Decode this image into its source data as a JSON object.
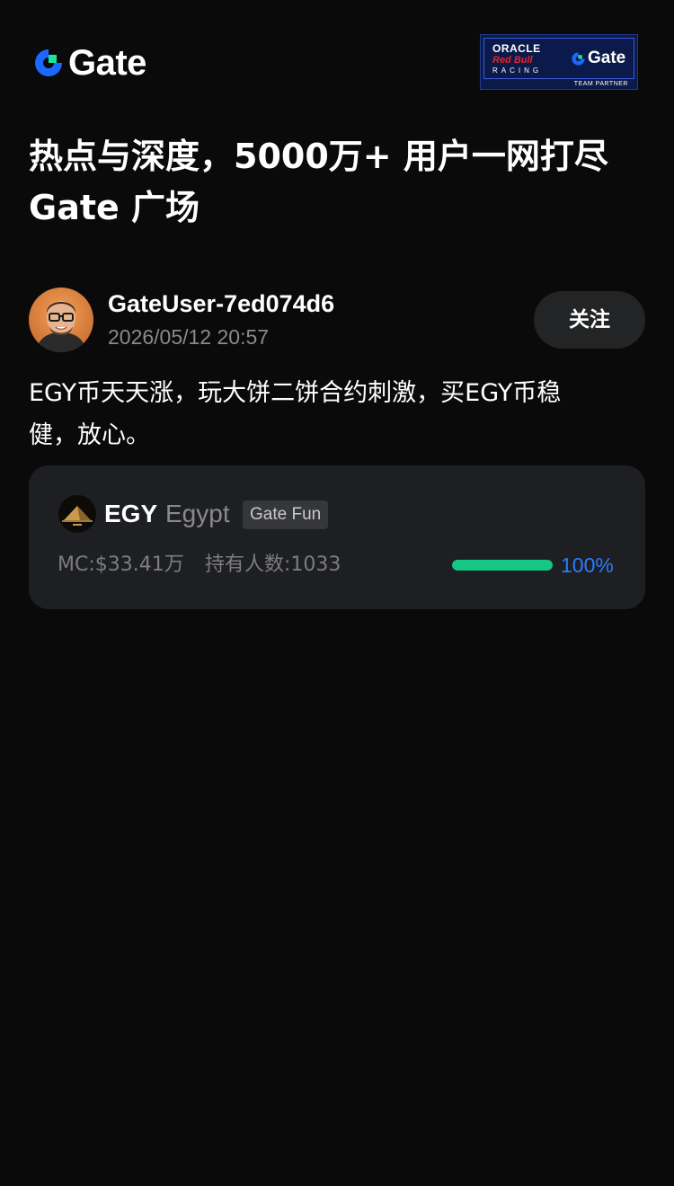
{
  "header": {
    "logo_text": "Gate",
    "partner_badge": {
      "line1": "ORACLE",
      "line2": "Red Bull",
      "line3": "RACING",
      "brand": "Gate",
      "caption": "TEAM PARTNER"
    }
  },
  "headline": {
    "line1": "热点与深度，5000万+ 用户一网打尽",
    "line2": "Gate 广场"
  },
  "post": {
    "author": "GateUser-7ed074d6",
    "timestamp": "2026/05/12 20:57",
    "follow_label": "关注",
    "text_line1": "EGY币天天涨，玩大饼二饼合约刺激，买EGY币稳",
    "text_line2": "健，放心。"
  },
  "token": {
    "symbol": "EGY",
    "name": "Egypt",
    "tag": "Gate Fun",
    "market_cap": "MC:$33.41万",
    "holders": "持有人数:1033",
    "progress_percent_label": "100%",
    "progress_value": 1.0
  },
  "colors": {
    "background": "#0a0a0a",
    "card": "#1e1f22",
    "accent_green": "#16c784",
    "accent_blue": "#2b7bff",
    "gate_green": "#17e6a1",
    "gate_blue": "#1a68ff"
  },
  "icons": {
    "logo": "gate-logo-icon",
    "token": "pyramid-token-icon",
    "avatar": "user-avatar"
  }
}
